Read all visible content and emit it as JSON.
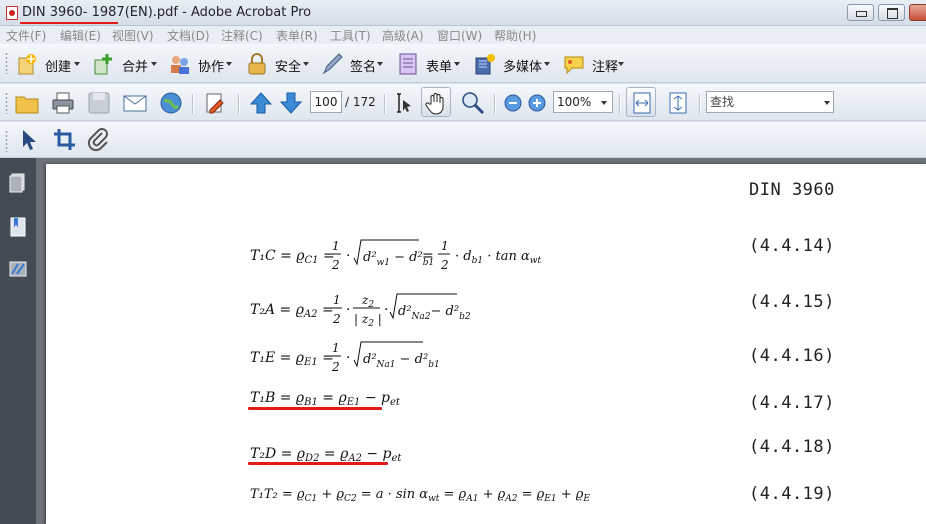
{
  "window": {
    "title": "DIN 3960- 1987(EN).pdf - Adobe Acrobat Pro"
  },
  "menu": [
    {
      "label": "文件(F)"
    },
    {
      "label": "编辑(E)"
    },
    {
      "label": "视图(V)"
    },
    {
      "label": "文档(D)"
    },
    {
      "label": "注释(C)"
    },
    {
      "label": "表单(R)"
    },
    {
      "label": "工具(T)"
    },
    {
      "label": "高级(A)"
    },
    {
      "label": "窗口(W)"
    },
    {
      "label": "帮助(H)"
    }
  ],
  "toolbar1": {
    "create": "创建",
    "combine": "合并",
    "collaborate": "协作",
    "secure": "安全",
    "sign": "签名",
    "forms": "表单",
    "multimedia": "多媒体",
    "comment": "注释"
  },
  "toolbar2": {
    "page_current": "100",
    "page_total": "/ 172",
    "zoom": "100%",
    "find_placeholder": "查找"
  },
  "document": {
    "standard": "DIN 3960",
    "equations": [
      {
        "text": "T₁C = ϱC1 = ½ · √(d²w1 − d²b1) = ½ · db1 · tan αwt",
        "number": "(4.4.14)"
      },
      {
        "text": "T₂A = ϱA2 = ½ · z2/|z2| · √(d²Na2 − d²b2)",
        "number": "(4.4.15)"
      },
      {
        "text": "T₁E = ϱE1 = ½ · √(d²Na1 − d²b1)",
        "number": "(4.4.16)"
      },
      {
        "text": "T₁B = ϱB1 = ϱE1 − pet",
        "number": "(4.4.17)"
      },
      {
        "text": "T₂D = ϱD2 = ϱA2 − pet",
        "number": "(4.4.18)"
      },
      {
        "text": "T₁T₂ = ϱC1 + ϱC2 = a · sin αwt = ϱA1 + ϱA2 = ϱE1 + ϱE2:",
        "number": "(4.4.19)"
      }
    ]
  },
  "colors": {
    "annotation_red": "#e01b1b",
    "nav_panel": "#444b55",
    "toolbar_bg": "#e6ecf3"
  }
}
